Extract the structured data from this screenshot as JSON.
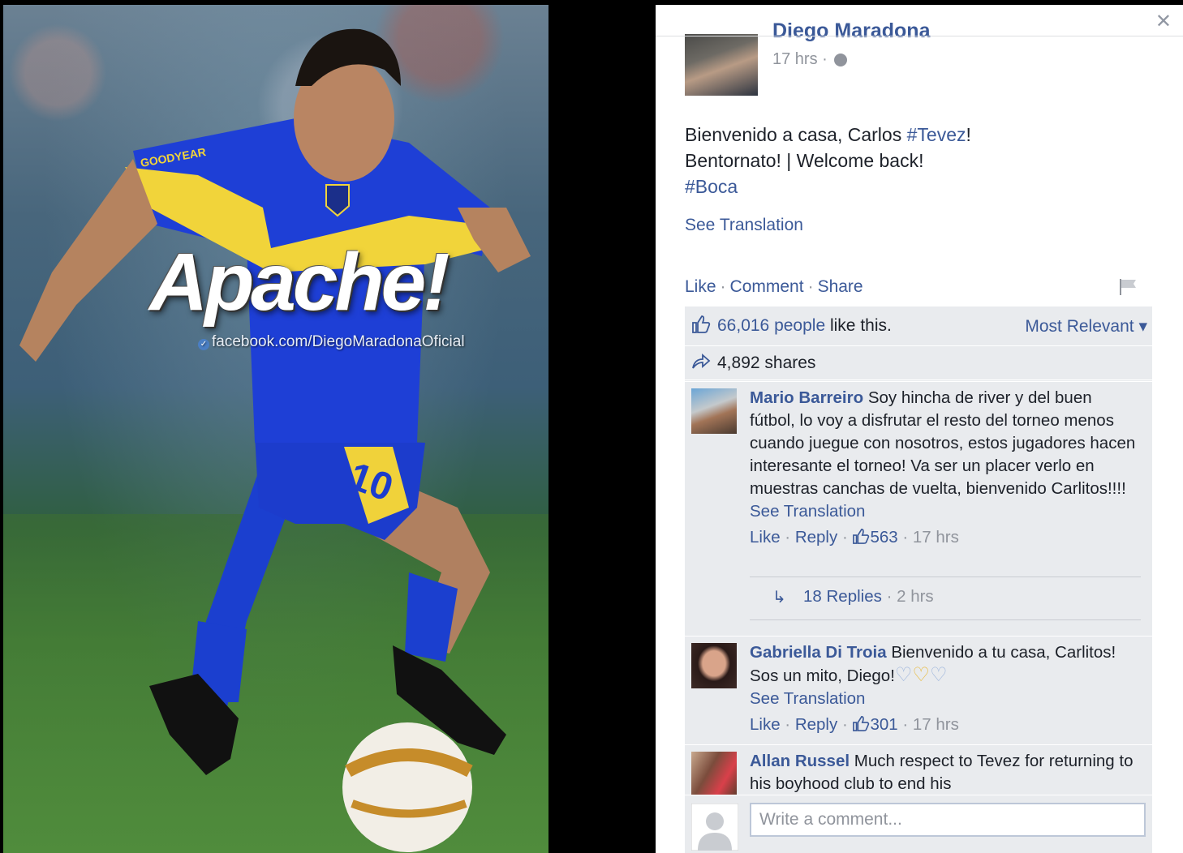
{
  "photo": {
    "overlay_text": "Apache!",
    "watermark": "facebook.com/DiegoMaradonaOficial",
    "shirt_text": "GOODYEAR",
    "shirt_number": "10"
  },
  "post": {
    "author": "Diego Maradona",
    "time": "17 hrs ·",
    "line1_prefix": "Bienvenido a casa, Carlos ",
    "line1_hashtag": "#Tevez",
    "line1_suffix": "!",
    "line2": "Bentornato! | Welcome back!",
    "line3_hashtag": "#Boca",
    "see_translation": "See Translation"
  },
  "actions": {
    "like": "Like",
    "comment": "Comment",
    "share": "Share",
    "sep": "·"
  },
  "ufi": {
    "likes_count": "66,016 people",
    "likes_suffix": " like this.",
    "shares": "4,892 shares",
    "sort": "Most Relevant"
  },
  "comments": [
    {
      "name": "Mario Barreiro",
      "text": " Soy hincha de river y del buen fútbol, lo voy a disfrutar el resto del torneo menos cuando juegue con nosotros, estos jugadores hacen interesante el torneo! Va ser un placer verlo en muestras canchas de vuelta, bienvenido Carlitos!!!!",
      "see_translation": "See Translation",
      "like": "Like",
      "reply": "Reply",
      "likes": "563",
      "time": "17 hrs",
      "replies": "18 Replies",
      "replies_time": "2 hrs"
    },
    {
      "name": "Gabriella Di Troia",
      "text": " Bienvenido a tu casa, Carlitos! Sos un mito, Diego!",
      "see_translation": "See Translation",
      "like": "Like",
      "reply": "Reply",
      "likes": "301",
      "time": "17 hrs"
    },
    {
      "name": "Allan Russel",
      "text": " Much respect to Tevez for returning to his boyhood club to end his"
    }
  ],
  "composer": {
    "placeholder": "Write a comment..."
  },
  "colors": {
    "link": "#3b5998",
    "ufi_bg": "#e9ebee",
    "muted": "#90949c"
  }
}
